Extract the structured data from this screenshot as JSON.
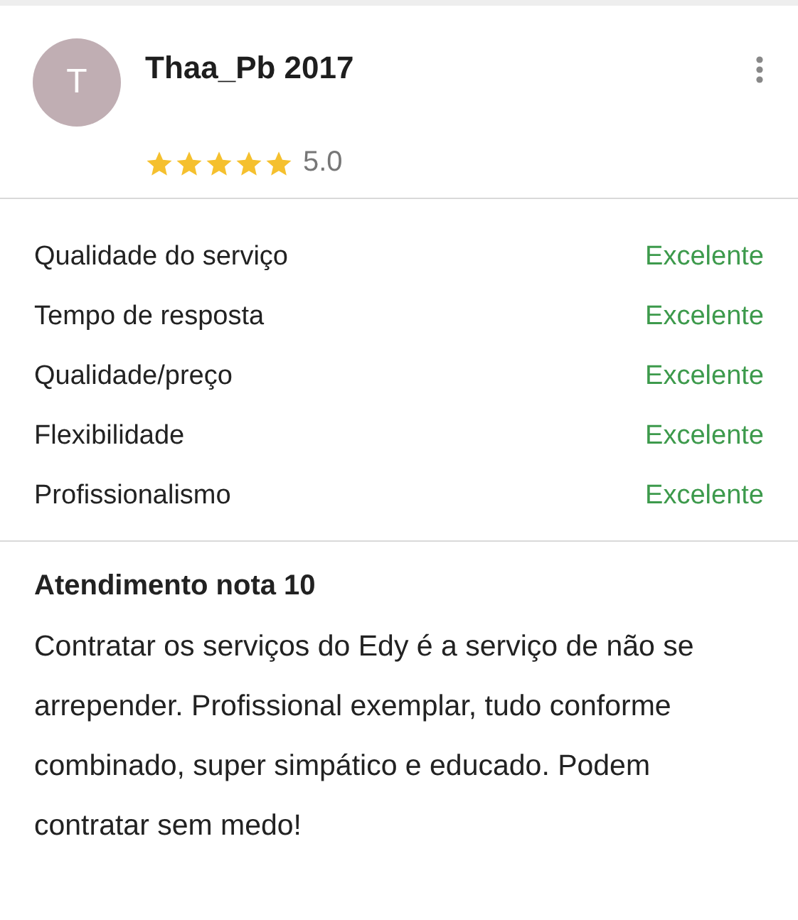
{
  "review": {
    "avatar_initial": "T",
    "author": "Thaa_Pb 2017",
    "stars": 5,
    "score": "5.0"
  },
  "ratings": [
    {
      "label": "Qualidade do serviço",
      "value": "Excelente"
    },
    {
      "label": "Tempo de resposta",
      "value": "Excelente"
    },
    {
      "label": "Qualidade/preço",
      "value": "Excelente"
    },
    {
      "label": "Flexibilidade",
      "value": "Excelente"
    },
    {
      "label": "Profissionalismo",
      "value": "Excelente"
    }
  ],
  "comment": {
    "title": "Atendimento nota 10",
    "body": "Contratar os serviços do Edy é a serviço de não se arrepender. Profissional exemplar, tudo conforme combinado, super simpático e educado. Podem contratar sem medo!"
  }
}
